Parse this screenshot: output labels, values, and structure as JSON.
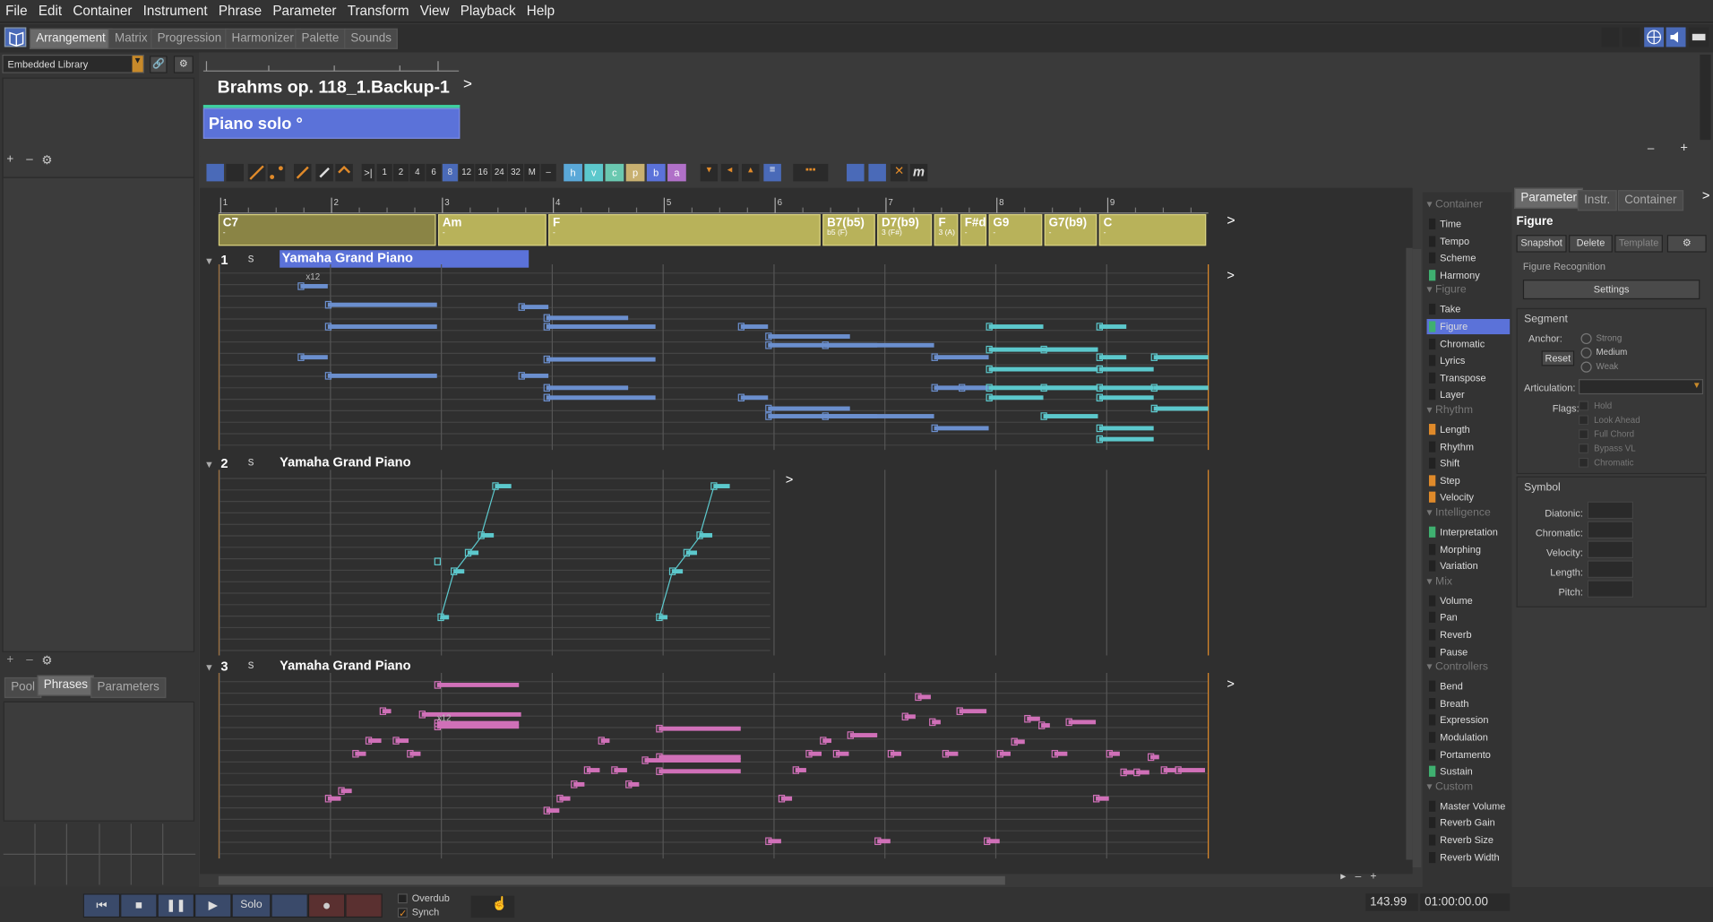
{
  "menu": [
    "File",
    "Edit",
    "Container",
    "Instrument",
    "Phrase",
    "Parameter",
    "Transform",
    "View",
    "Playback",
    "Help"
  ],
  "tabs": [
    "Arrangement",
    "Matrix",
    "Progression",
    "Harmonizer",
    "Palette",
    "Sounds"
  ],
  "library": {
    "selected": "Embedded Library"
  },
  "song": {
    "title": "Brahms op. 118_1.Backup-1",
    "phrase": "Piano solo °"
  },
  "ruler": [
    "1",
    "2",
    "3",
    "4",
    "5",
    "6",
    "7",
    "8",
    "9"
  ],
  "snap": [
    "1",
    "2",
    "4",
    "6",
    "8",
    "12",
    "16",
    "24",
    "32",
    "M",
    "–"
  ],
  "modes": [
    "h",
    "v",
    "c",
    "p",
    "b",
    "a"
  ],
  "chords": [
    {
      "name": "C7",
      "sub": "-"
    },
    {
      "name": "Am",
      "sub": "-"
    },
    {
      "name": "F",
      "sub": "-"
    },
    {
      "name": "B7(b5)",
      "sub": "b5 (F)"
    },
    {
      "name": "D7(b9)",
      "sub": "3 (F#)"
    },
    {
      "name": "F",
      "sub": "3 (A)"
    },
    {
      "name": "F#d",
      "sub": "-"
    },
    {
      "name": "G9",
      "sub": "-"
    },
    {
      "name": "G7(b9)",
      "sub": "-"
    },
    {
      "name": "C",
      "sub": "-"
    }
  ],
  "tracks": [
    {
      "num": "1",
      "s": "s",
      "name": "Yamaha Grand Piano"
    },
    {
      "num": "2",
      "s": "s",
      "name": "Yamaha Grand Piano"
    },
    {
      "num": "3",
      "s": "s",
      "name": "Yamaha Grand Piano"
    }
  ],
  "bottom_tabs": [
    "Pool",
    "Phrases",
    "Parameters"
  ],
  "params": {
    "sections": [
      "Container",
      "Figure",
      "Rhythm",
      "Intelligence",
      "Mix",
      "Controllers",
      "Custom"
    ],
    "items": [
      "Time",
      "Tempo",
      "Scheme",
      "Harmony",
      "Take",
      "Figure",
      "Chromatic",
      "Lyrics",
      "Transpose",
      "Layer",
      "Length",
      "Rhythm",
      "Shift",
      "Step",
      "Velocity",
      "Interpretation",
      "Morphing",
      "Variation",
      "Volume",
      "Pan",
      "Reverb",
      "Pause",
      "Bend",
      "Breath",
      "Expression",
      "Modulation",
      "Portamento",
      "Sustain",
      "Master Volume",
      "Reverb Gain",
      "Reverb Size",
      "Reverb Width"
    ]
  },
  "inspector": {
    "tabs": [
      "Parameter",
      "Instr.",
      "Container"
    ],
    "title": "Figure",
    "buttons": [
      "Snapshot",
      "Delete",
      "Template"
    ],
    "recognition": "Figure Recognition",
    "settings": "Settings",
    "segment": "Segment",
    "anchor": "Anchor:",
    "reset": "Reset",
    "anchors": [
      "Strong",
      "Medium",
      "Weak"
    ],
    "articulation": "Articulation:",
    "flags": "Flags:",
    "flaglist": [
      "Hold",
      "Look Ahead",
      "Full Chord",
      "Bypass VL",
      "Chromatic"
    ],
    "symbol": "Symbol",
    "symbolfields": [
      "Diatonic:",
      "Chromatic:",
      "Velocity:",
      "Length:",
      "Pitch:"
    ]
  },
  "transport": {
    "solo": "Solo",
    "overdub": "Overdub",
    "synch": "Synch",
    "tempo": "143.99",
    "time": "01:00:00.00"
  },
  "colors": {
    "track1": "#6b8fce",
    "track2": "#5cc8cc",
    "track3": "#d070b8",
    "chordbar": "#b8b25a",
    "phrase": "#5b72d9"
  }
}
